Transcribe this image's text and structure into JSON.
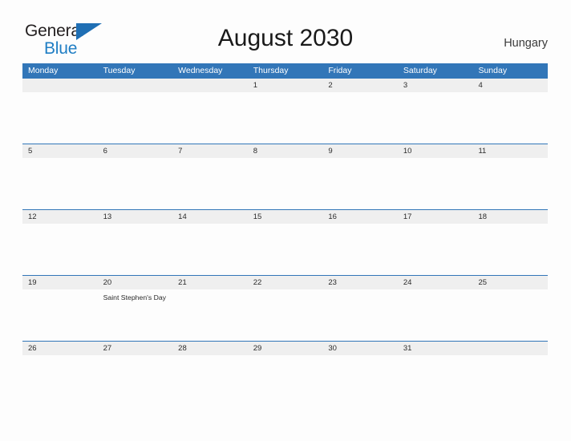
{
  "logo": {
    "line1": "General",
    "line2": "Blue",
    "triangle_color": "#1f6fb4",
    "line2_color": "#1f7ec4",
    "icon": "general-blue-logo"
  },
  "header": {
    "title": "August 2030",
    "country": "Hungary"
  },
  "colors": {
    "header_bar": "#3276b8",
    "number_band": "#efefef",
    "separator": "#3276b8",
    "page_background": "#fdfdfd",
    "text": "#2b2b2b"
  },
  "calendar": {
    "weekdays": [
      "Monday",
      "Tuesday",
      "Wednesday",
      "Thursday",
      "Friday",
      "Saturday",
      "Sunday"
    ],
    "weeks": [
      [
        {
          "day": "",
          "event": ""
        },
        {
          "day": "",
          "event": ""
        },
        {
          "day": "",
          "event": ""
        },
        {
          "day": "1",
          "event": ""
        },
        {
          "day": "2",
          "event": ""
        },
        {
          "day": "3",
          "event": ""
        },
        {
          "day": "4",
          "event": ""
        }
      ],
      [
        {
          "day": "5",
          "event": ""
        },
        {
          "day": "6",
          "event": ""
        },
        {
          "day": "7",
          "event": ""
        },
        {
          "day": "8",
          "event": ""
        },
        {
          "day": "9",
          "event": ""
        },
        {
          "day": "10",
          "event": ""
        },
        {
          "day": "11",
          "event": ""
        }
      ],
      [
        {
          "day": "12",
          "event": ""
        },
        {
          "day": "13",
          "event": ""
        },
        {
          "day": "14",
          "event": ""
        },
        {
          "day": "15",
          "event": ""
        },
        {
          "day": "16",
          "event": ""
        },
        {
          "day": "17",
          "event": ""
        },
        {
          "day": "18",
          "event": ""
        }
      ],
      [
        {
          "day": "19",
          "event": ""
        },
        {
          "day": "20",
          "event": "Saint Stephen's Day"
        },
        {
          "day": "21",
          "event": ""
        },
        {
          "day": "22",
          "event": ""
        },
        {
          "day": "23",
          "event": ""
        },
        {
          "day": "24",
          "event": ""
        },
        {
          "day": "25",
          "event": ""
        }
      ],
      [
        {
          "day": "26",
          "event": ""
        },
        {
          "day": "27",
          "event": ""
        },
        {
          "day": "28",
          "event": ""
        },
        {
          "day": "29",
          "event": ""
        },
        {
          "day": "30",
          "event": ""
        },
        {
          "day": "31",
          "event": ""
        },
        {
          "day": "",
          "event": ""
        }
      ]
    ]
  }
}
